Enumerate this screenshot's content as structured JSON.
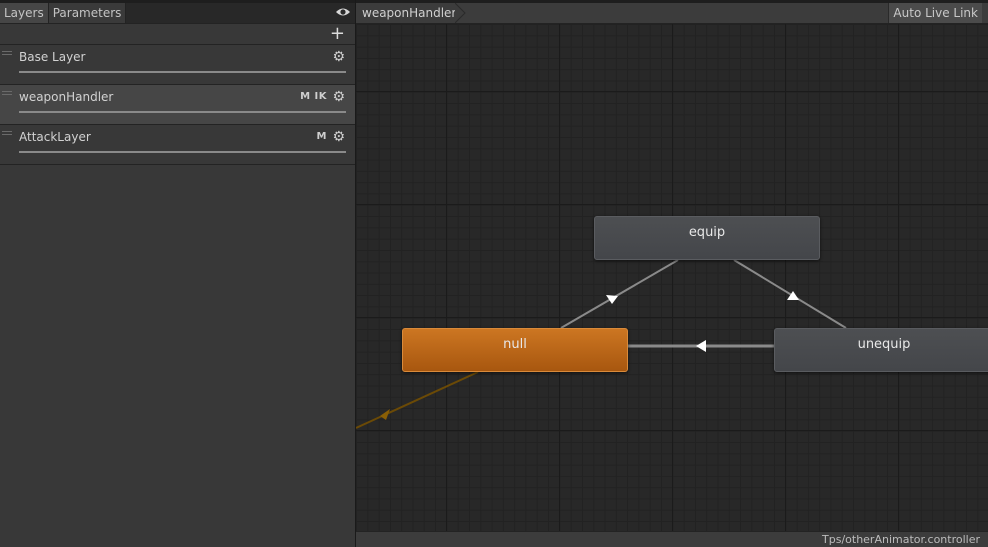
{
  "tabs": [
    {
      "label": "Layers",
      "active": true
    },
    {
      "label": "Parameters",
      "active": false
    }
  ],
  "icons": {
    "visibility": "eye-icon",
    "add": "plus-icon",
    "settings": "gear-icon"
  },
  "add_label": "+",
  "layers": [
    {
      "name": "Base Layer",
      "flags": "",
      "selected": false
    },
    {
      "name": "weaponHandler",
      "flags": "M IK",
      "selected": true
    },
    {
      "name": "AttackLayer",
      "flags": "M",
      "selected": false
    }
  ],
  "breadcrumb": "weaponHandler",
  "auto_live_link": "Auto Live Link",
  "states": {
    "equip": "equip",
    "null": "null",
    "unequip": "unequip"
  },
  "default_state_color": "#cc7622",
  "footer_path": "Tps/otherAnimator.controller"
}
